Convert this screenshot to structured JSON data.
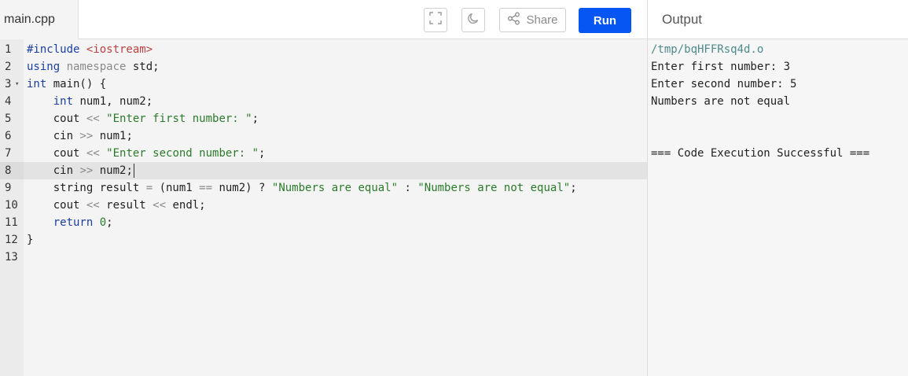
{
  "file_tab": {
    "label": "main.cpp"
  },
  "toolbar": {
    "fullscreen_icon": "fullscreen-icon",
    "theme_icon": "moon-icon",
    "share_label": "Share",
    "run_label": "Run",
    "accent": "#0556f3"
  },
  "output": {
    "title": "Output",
    "lines": [
      "/tmp/bqHFFRsq4d.o",
      "Enter first number: 3",
      "Enter second number: 5",
      "Numbers are not equal",
      "",
      "",
      "=== Code Execution Successful ==="
    ]
  },
  "editor": {
    "active_line": 8,
    "lines": [
      {
        "n": "1",
        "fold": "",
        "tokens": [
          [
            "pp",
            "#include "
          ],
          [
            "inc",
            "<iostream>"
          ]
        ]
      },
      {
        "n": "2",
        "fold": "",
        "tokens": [
          [
            "kw",
            "using "
          ],
          [
            "ns",
            "namespace "
          ],
          [
            "plain",
            "std;"
          ]
        ]
      },
      {
        "n": "3",
        "fold": "▾",
        "tokens": [
          [
            "kw",
            "int "
          ],
          [
            "plain",
            "main() {"
          ]
        ]
      },
      {
        "n": "4",
        "fold": "",
        "tokens": [
          [
            "plain",
            "    "
          ],
          [
            "kw",
            "int "
          ],
          [
            "plain",
            "num1, num2;"
          ]
        ]
      },
      {
        "n": "5",
        "fold": "",
        "tokens": [
          [
            "plain",
            "    cout "
          ],
          [
            "op",
            "<< "
          ],
          [
            "str",
            "\"Enter first number: \""
          ],
          [
            "plain",
            ";"
          ]
        ]
      },
      {
        "n": "6",
        "fold": "",
        "tokens": [
          [
            "plain",
            "    cin "
          ],
          [
            "op",
            ">> "
          ],
          [
            "plain",
            "num1;"
          ]
        ]
      },
      {
        "n": "7",
        "fold": "",
        "tokens": [
          [
            "plain",
            "    cout "
          ],
          [
            "op",
            "<< "
          ],
          [
            "str",
            "\"Enter second number: \""
          ],
          [
            "plain",
            ";"
          ]
        ]
      },
      {
        "n": "8",
        "fold": "",
        "tokens": [
          [
            "plain",
            "    cin "
          ],
          [
            "op",
            ">> "
          ],
          [
            "plain",
            "num2;"
          ]
        ]
      },
      {
        "n": "9",
        "fold": "",
        "tokens": [
          [
            "plain",
            "    string result "
          ],
          [
            "op",
            "= "
          ],
          [
            "plain",
            "(num1 "
          ],
          [
            "op",
            "== "
          ],
          [
            "plain",
            "num2) ? "
          ],
          [
            "str",
            "\"Numbers are equal\""
          ],
          [
            "plain",
            " : "
          ],
          [
            "str",
            "\"Numbers are not equal\""
          ],
          [
            "plain",
            ";"
          ]
        ]
      },
      {
        "n": "10",
        "fold": "",
        "tokens": [
          [
            "plain",
            "    cout "
          ],
          [
            "op",
            "<< "
          ],
          [
            "plain",
            "result "
          ],
          [
            "op",
            "<< "
          ],
          [
            "plain",
            "endl;"
          ]
        ]
      },
      {
        "n": "11",
        "fold": "",
        "tokens": [
          [
            "plain",
            "    "
          ],
          [
            "kw",
            "return "
          ],
          [
            "num",
            "0"
          ],
          [
            "plain",
            ";"
          ]
        ]
      },
      {
        "n": "12",
        "fold": "",
        "tokens": [
          [
            "plain",
            "}"
          ]
        ]
      },
      {
        "n": "13",
        "fold": "",
        "tokens": []
      }
    ]
  }
}
